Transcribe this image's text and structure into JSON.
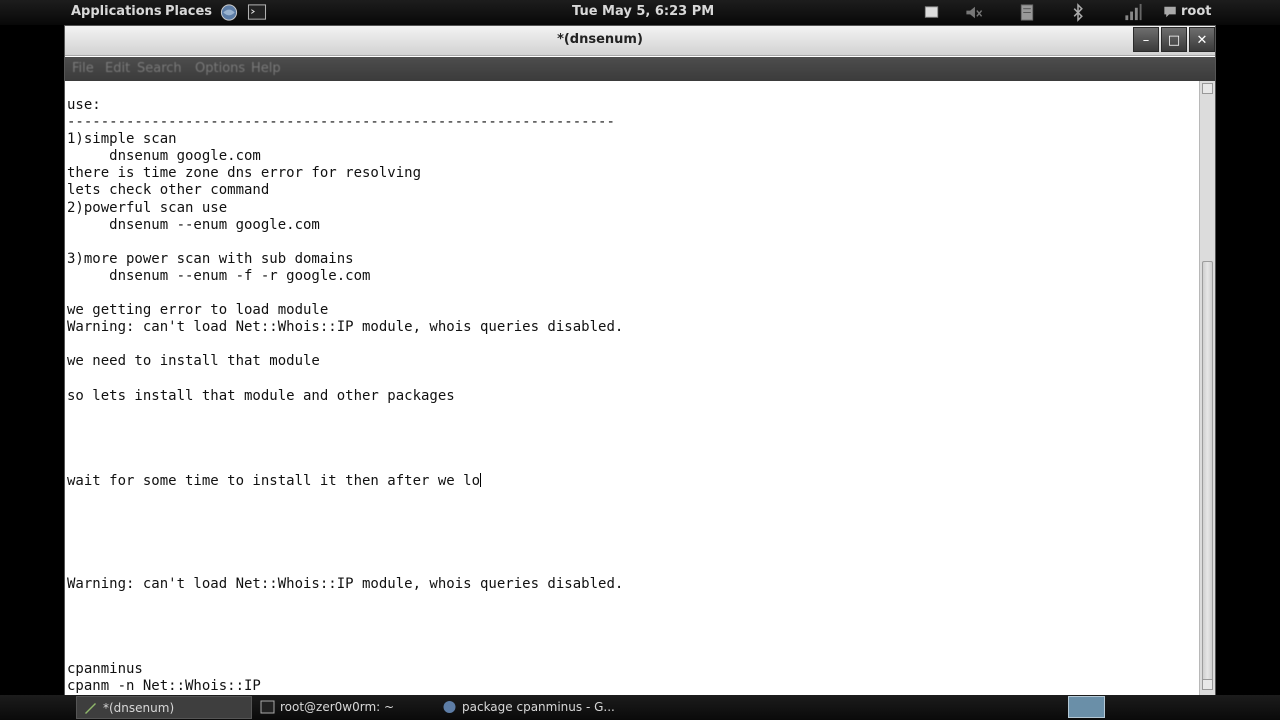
{
  "top_panel": {
    "applications": "Applications",
    "places": "Places",
    "clock": "Tue May  5,  6:23 PM",
    "user": "root",
    "icons": [
      "browser-icon",
      "terminal-launcher-icon",
      "display-icon",
      "volume-muted-icon",
      "network-icon",
      "bluetooth-icon",
      "signal-icon",
      "chat-icon"
    ]
  },
  "window": {
    "title": "*(dnsenum)",
    "controls": {
      "minimize": "–",
      "maximize": "□",
      "close": "✕"
    },
    "menu": [
      "File",
      "Edit",
      "Search",
      "Options",
      "Help"
    ]
  },
  "terminal": {
    "lines": [
      "use:",
      "-----------------------------------------------------------------",
      "1)simple scan",
      "     dnsenum google.com",
      "there is time zone dns error for resolving",
      "lets check other command",
      "2)powerful scan use",
      "     dnsenum --enum google.com",
      "",
      "3)more power scan with sub domains",
      "     dnsenum --enum -f -r google.com",
      "",
      "we getting error to load module",
      "Warning: can't load Net::Whois::IP module, whois queries disabled.",
      "",
      "we need to install that module",
      "",
      "so lets install that module and other packages",
      "",
      "",
      "",
      "",
      "wait for some time to install it then after we lo",
      "",
      "",
      "",
      "",
      "",
      "Warning: can't load Net::Whois::IP module, whois queries disabled.",
      "",
      "",
      "",
      "",
      "cpanminus",
      "cpanm -n Net::Whois::IP"
    ]
  },
  "taskbar": {
    "tasks": [
      {
        "label": "*(dnsenum)",
        "icon": "editor-icon"
      },
      {
        "label": "root@zer0w0rm: ~",
        "icon": "terminal-icon"
      },
      {
        "label": "package cpanminus - G...",
        "icon": "browser-icon"
      }
    ]
  }
}
